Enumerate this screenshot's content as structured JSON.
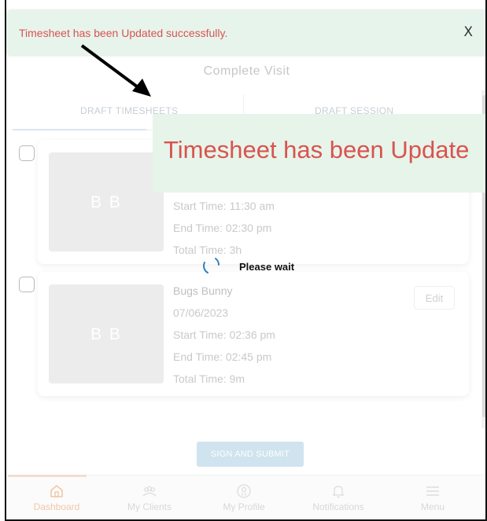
{
  "toast": {
    "message": "Timesheet has been Updated successfully.",
    "close_label": "X"
  },
  "page": {
    "title": "Complete Visit"
  },
  "tabs": [
    {
      "label": "DRAFT TIMESHEETS"
    },
    {
      "label": "DRAFT SESSION"
    }
  ],
  "overlay": {
    "banner_text": "Timesheet has been Update",
    "wait_text": "Please wait"
  },
  "timesheets": [
    {
      "initials": "B B",
      "name": "",
      "date": "",
      "start": "Start Time: 11:30 am",
      "end": "End Time: 02:30 pm",
      "total": "Total Time: 3h"
    },
    {
      "initials": "B B",
      "name": "Bugs Bunny",
      "date": "07/06/2023",
      "start": "Start Time: 02:36 pm",
      "end": "End Time: 02:45 pm",
      "total": "Total Time: 9m",
      "edit_label": "Edit"
    }
  ],
  "actions": {
    "submit_label": "SIGN AND SUBMIT"
  },
  "nav": [
    {
      "label": "Dashboard",
      "icon": "home-icon",
      "active": true
    },
    {
      "label": "My Clients",
      "icon": "users-icon"
    },
    {
      "label": "My Profile",
      "icon": "profile-icon"
    },
    {
      "label": "Notifications",
      "icon": "bell-icon"
    },
    {
      "label": "Menu",
      "icon": "menu-icon"
    }
  ],
  "colors": {
    "toast_text": "#d9534f",
    "toast_bg": "#e7f4ec",
    "accent": "#f2c7a8"
  }
}
